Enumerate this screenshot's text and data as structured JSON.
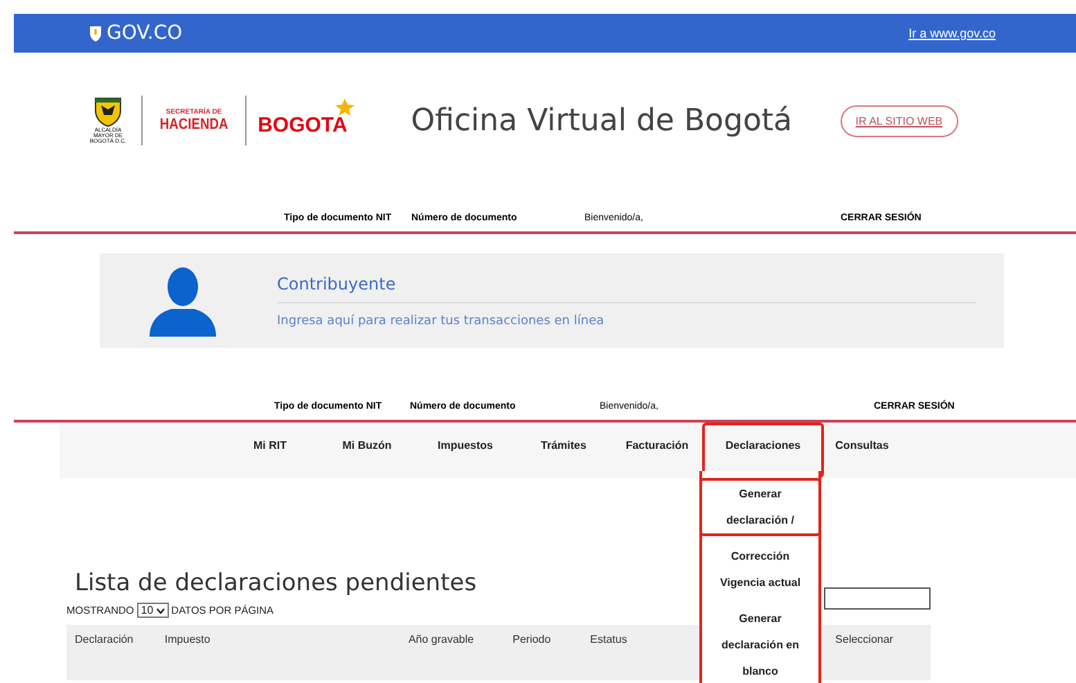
{
  "gov_bar": {
    "logo_text": "GOV.CO",
    "link": "Ir a www.gov.co"
  },
  "header": {
    "alcaldia": "ALCALDÍA MAYOR DE BOGOTÁ D.C.",
    "secretaria": "SECRETARÍA DE",
    "hacienda": "HACIENDA",
    "bogota": "BOGOTA",
    "title": "Oficina Virtual de Bogotá",
    "site_button": "IR AL SITIO WEB"
  },
  "user_bar_top": {
    "doc_type": "Tipo de documento NIT",
    "doc_number": "Número de documento",
    "welcome": "Bienvenido/a,",
    "logout": "CERRAR SESIÓN"
  },
  "profile_card": {
    "title": "Contribuyente",
    "link": "Ingresa aquí para realizar tus transacciones en línea"
  },
  "user_bar_bottom": {
    "doc_type": "Tipo de documento NIT",
    "doc_number": "Número de documento",
    "welcome": "Bienvenido/a,",
    "logout": "CERRAR SESIÓN"
  },
  "nav": [
    {
      "label": "Mi RIT",
      "highlighted": false
    },
    {
      "label": "Mi Buzón",
      "highlighted": false
    },
    {
      "label": "Impuestos",
      "highlighted": false
    },
    {
      "label": "Trámites",
      "highlighted": false
    },
    {
      "label": "Facturación",
      "highlighted": false
    },
    {
      "label": "Declaraciones",
      "highlighted": true
    },
    {
      "label": "Consultas",
      "highlighted": false
    }
  ],
  "dropdown": [
    {
      "label": "Generar declaración /",
      "highlighted": true
    },
    {
      "label": "Corrección Vigencia actual",
      "highlighted": false
    },
    {
      "label": "Generar declaración en blanco",
      "highlighted": false
    }
  ],
  "list": {
    "title": "Lista de declaraciones pendientes",
    "showing": "MOSTRANDO",
    "page_size": "10",
    "per_page": "DATOS POR PÁGINA"
  },
  "table": {
    "columns": [
      "Declaración",
      "Impuesto",
      "Año gravable",
      "Periodo",
      "Estatus",
      "Seleccionar"
    ]
  }
}
